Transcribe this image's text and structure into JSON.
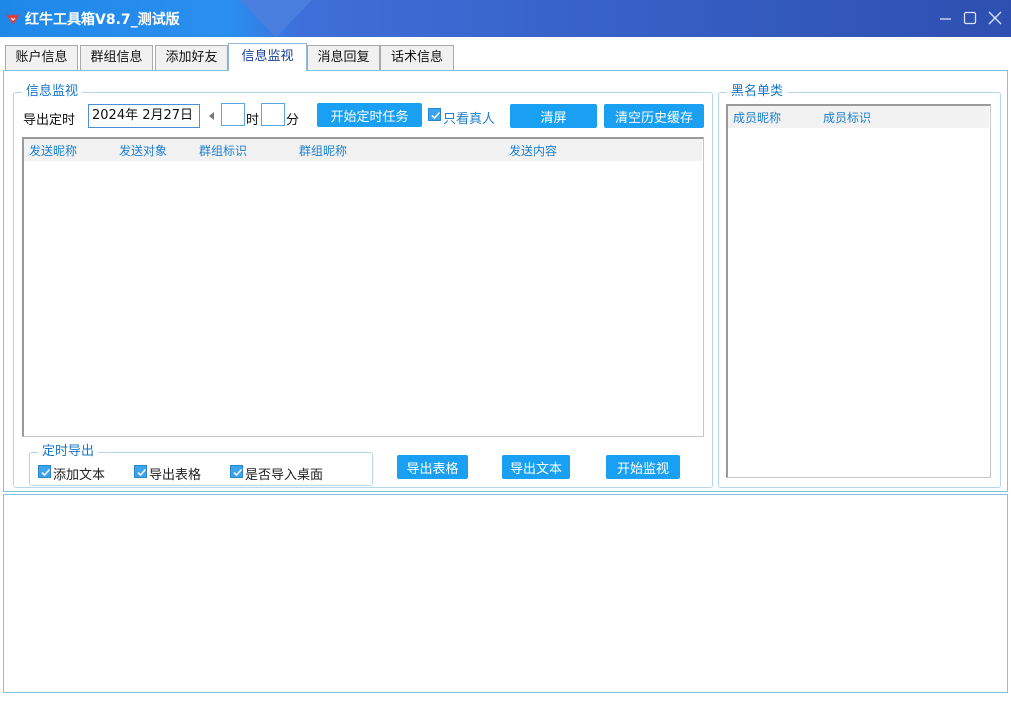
{
  "window": {
    "title": "红牛工具箱V8.7_测试版",
    "controls": [
      "minimize-icon",
      "maximize-icon",
      "close-icon"
    ]
  },
  "tabs": [
    {
      "label": "账户信息",
      "active": false
    },
    {
      "label": "群组信息",
      "active": false
    },
    {
      "label": "添加好友",
      "active": false
    },
    {
      "label": "信息监视",
      "active": true
    },
    {
      "label": "消息回复",
      "active": false
    },
    {
      "label": "话术信息",
      "active": false
    }
  ],
  "monitor": {
    "legend": "信息监视",
    "export_timer_label": "导出定时",
    "date_value": "2024年  2月27日",
    "hour_value": "",
    "hour_label": "时",
    "minute_value": "",
    "minute_label": "分",
    "start_timer_button": "开始定时任务",
    "real_only": {
      "label": "只看真人",
      "checked": true
    },
    "clear_screen_button": "清屏",
    "clear_cache_button": "清空历史缓存",
    "columns": [
      "发送昵称",
      "发送对象",
      "群组标识",
      "群组昵称",
      "发送内容"
    ],
    "rows": []
  },
  "timed_export": {
    "legend": "定时导出",
    "options": [
      {
        "label": "添加文本",
        "checked": true
      },
      {
        "label": "导出表格",
        "checked": true
      },
      {
        "label": "是否导入桌面",
        "checked": true
      }
    ],
    "export_table_button": "导出表格",
    "export_text_button": "导出文本",
    "start_monitor_button": "开始监视"
  },
  "blacklist": {
    "legend": "黑名单类",
    "columns": [
      "成员昵称",
      "成员标识"
    ],
    "rows": []
  },
  "colors": {
    "accent": "#1aa0f2",
    "titlebar": "#2a8ff0",
    "header_text": "#1d7fcf",
    "panel_border": "#7fc4df"
  }
}
